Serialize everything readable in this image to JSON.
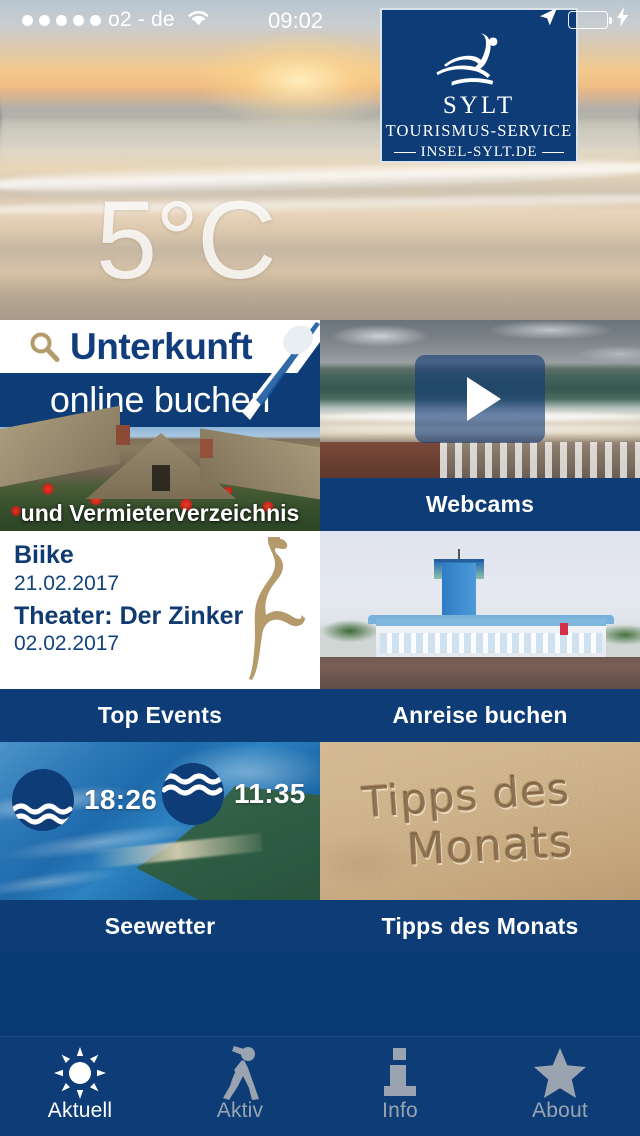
{
  "status_bar": {
    "signal_dots": 5,
    "carrier": "o2 - de",
    "wifi_icon": "wifi-icon",
    "time": "09:02",
    "location_icon": "location-arrow-icon",
    "battery_icon": "battery-charging-icon",
    "battery_color": "#4cd763"
  },
  "logo": {
    "mark": "sylt-surfer-wave-mark",
    "title": "SYLT",
    "subtitle": "TOURISMUS-SERVICE",
    "url": "INSEL-SYLT.DE",
    "background": "#0d3c76"
  },
  "hero": {
    "temperature": "5°C",
    "image": "sunset-beach-photo"
  },
  "tiles": {
    "unterkunft": {
      "search_icon": "magnifier-icon",
      "title": "Unterkunft",
      "subtitle": "online buchen",
      "caption": "und Vermieterverzeichnis",
      "image": "thatched-house-poppies-photo"
    },
    "webcams": {
      "label": "Webcams",
      "play_icon": "play-icon",
      "image": "beach-webcam-photo"
    },
    "top_events": {
      "label": "Top Events",
      "island_icon": "sylt-island-silhouette-icon",
      "events": [
        {
          "title": "Biike",
          "date": "21.02.2017"
        },
        {
          "title": "Theater: Der Zinker",
          "date": "02.02.2017"
        }
      ]
    },
    "anreise": {
      "label": "Anreise buchen",
      "image": "sylt-airport-photo"
    },
    "seewetter": {
      "label": "Seewetter",
      "image": "sylt-aerial-photo",
      "tides": [
        {
          "icon": "low-tide-wave-icon",
          "time": "18:26"
        },
        {
          "icon": "high-tide-wave-icon",
          "time": "11:35"
        }
      ]
    },
    "tipps": {
      "label": "Tipps des Monats",
      "image": "sand-writing-photo",
      "sand_text_line1": "Tipps des",
      "sand_text_line2": "Monats"
    }
  },
  "tabbar": {
    "background": "#0d3c76",
    "items": [
      {
        "label": "Aktuell",
        "icon": "sun-icon",
        "active": true
      },
      {
        "label": "Aktiv",
        "icon": "dancing-person-icon",
        "active": false
      },
      {
        "label": "Info",
        "icon": "info-icon",
        "active": false
      },
      {
        "label": "About",
        "icon": "star-icon",
        "active": false
      }
    ]
  },
  "colors": {
    "navy": "#0d3c76",
    "navy_text": "#123d7c",
    "gold": "#b59a6c",
    "inactive": "#9aa4b0"
  }
}
